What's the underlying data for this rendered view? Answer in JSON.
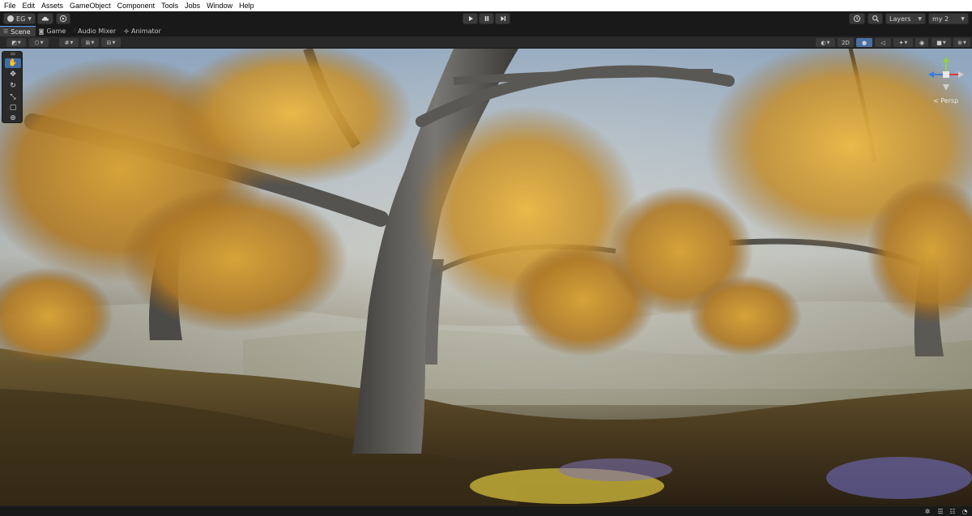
{
  "menu": [
    "File",
    "Edit",
    "Assets",
    "GameObject",
    "Component",
    "Tools",
    "Jobs",
    "Window",
    "Help"
  ],
  "toolbar": {
    "account_label": "EG",
    "account_icon": "account-icon",
    "cloud_icon": "cloud-icon",
    "collab_icon": "collab-icon",
    "play_icon": "play-icon",
    "pause_icon": "pause-icon",
    "step_icon": "step-icon",
    "history_icon": "history-icon",
    "search_icon": "search-icon",
    "layers_label": "Layers",
    "layout_label": "my 2"
  },
  "tabs": [
    {
      "label": "Scene",
      "icon": "scene-icon",
      "active": true
    },
    {
      "label": "Game",
      "icon": "game-icon",
      "active": false
    },
    {
      "label": "Audio Mixer",
      "icon": "audio-mixer-icon",
      "active": false
    },
    {
      "label": "Animator",
      "icon": "animator-icon",
      "active": false
    }
  ],
  "scene_toolbar": {
    "mode_2d_label": "2D"
  },
  "tools": [
    "hand-tool",
    "move-tool",
    "rotate-tool",
    "scale-tool",
    "rect-tool",
    "transform-tool"
  ],
  "viewport": {
    "projection_label": "< Persp"
  },
  "colors": {
    "accent": "#3d6eaa",
    "gizmo_x": "#e03a3a",
    "gizmo_y": "#8fd23b",
    "gizmo_z": "#3a7de0"
  }
}
